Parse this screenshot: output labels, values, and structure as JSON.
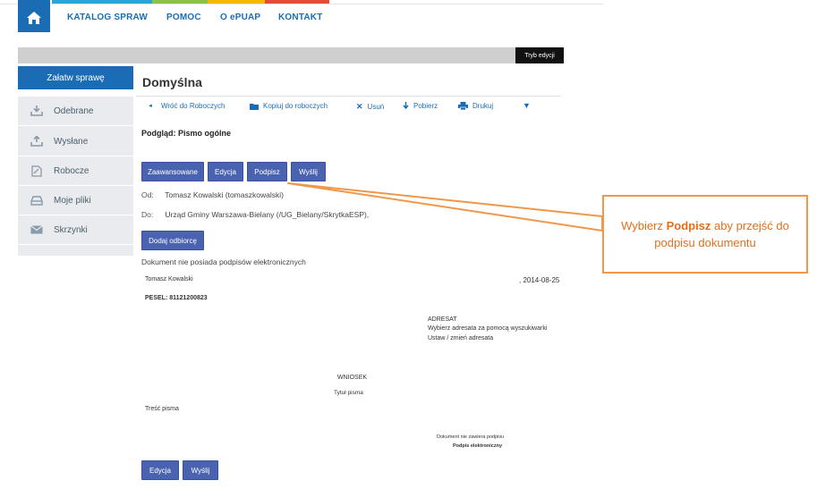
{
  "nav": {
    "items": [
      "KATALOG SPRAW",
      "POMOC",
      "O ePUAP",
      "KONTAKT"
    ]
  },
  "edit_mode": "Tryb edycji",
  "sidebar": {
    "action": "Załatw sprawę",
    "items": [
      {
        "label": "Odebrane",
        "icon": "inbox-down-icon"
      },
      {
        "label": "Wysłane",
        "icon": "inbox-up-icon"
      },
      {
        "label": "Robocze",
        "icon": "draft-icon"
      },
      {
        "label": "Moje pliki",
        "icon": "drive-icon"
      },
      {
        "label": "Skrzynki",
        "icon": "envelope-icon"
      }
    ]
  },
  "main": {
    "title": "Domyślna",
    "toolbar": {
      "back": "Wróć do Roboczych",
      "copy": "Kopiuj do roboczych",
      "delete": "Usuń",
      "download": "Pobierz",
      "print": "Drukuj"
    },
    "preview_title": "Podgląd: Pismo ogólne",
    "buttons": {
      "advanced": "Zaawansowane",
      "edit": "Edycja",
      "sign": "Podpisz",
      "send": "Wyślij"
    },
    "from_label": "Od:",
    "from_value": "Tomasz Kowalski (tomaszkowalski)",
    "to_label": "Do:",
    "to_value": "Urząd Gminy Warszawa-Bielany (/UG_Bielany/SkrytkaESP),",
    "add_recipient": "Dodaj odbiorcę",
    "no_signatures": "Dokument nie posiada podpisów elektronicznych"
  },
  "document": {
    "sender": "Tomasz Kowalski",
    "date": ", 2014-08-25",
    "pesel": "PESEL: 81121200823",
    "addressee_label": "ADRESAT",
    "addressee_hint": "Wybierz adresata za pomocą wyszukiwarki",
    "addressee_action": "Ustaw / zmień adresata",
    "heading": "WNIOSEK",
    "subject": "Tytuł pisma",
    "body_label": "Treść pisma",
    "sig_note": "Dokument nie zawiera podpisu",
    "sig_label": "Podpis elektroniczny"
  },
  "bottom_buttons": {
    "edit": "Edycja",
    "send": "Wyślij"
  },
  "callout": {
    "before": "Wybierz ",
    "bold": "Podpisz",
    "after": " aby przejść do podpisu dokumentu"
  },
  "colors": {
    "accent": "#1a6db5",
    "button": "#4a63b0",
    "callout": "#f0974a"
  }
}
